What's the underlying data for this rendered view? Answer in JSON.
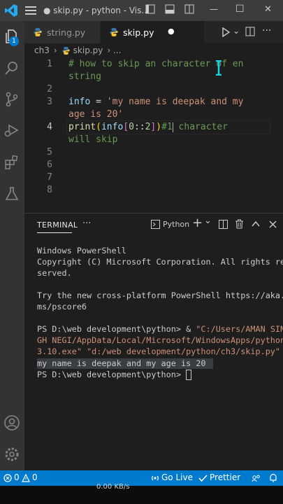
{
  "titlebar": {
    "title": "● skip.py - python - Vis...",
    "minimize": "—",
    "maximize": "☐",
    "close": "✕"
  },
  "activity": {
    "explorer_badge": "1"
  },
  "tabs": [
    {
      "label": "string.py",
      "active": false
    },
    {
      "label": "skip.py",
      "active": true,
      "dirty_marker": "●"
    }
  ],
  "breadcrumb": {
    "folder": "ch3",
    "separator": "›",
    "file": "skip.py",
    "more": "› ..."
  },
  "editor": {
    "line_numbers": [
      "1",
      "",
      "2",
      "3",
      "",
      "4",
      "",
      "5",
      "6",
      "7",
      "8"
    ],
    "lines": {
      "l1a": "# how to skip an character of en",
      "l1b": "string",
      "l3_var": "info",
      "l3_eq": " = ",
      "l3_str": "'my name is deepak and my",
      "l3_str2": "age is 20'",
      "l4_fn": "print",
      "l4_p1": "(",
      "l4_var": "info",
      "l4_b1": "[",
      "l4_num": "0",
      "l4_op": "::",
      "l4_num2": "2",
      "l4_b2": "]",
      "l4_p2": ")",
      "l4_cmt": "#1",
      "l4_cmt2": " character",
      "l4_cmt3": "will skip"
    }
  },
  "terminal_panel": {
    "tab": "TERMINAL",
    "more": "···",
    "shell": "Python",
    "add": "+",
    "chevron": "⌄"
  },
  "terminal": {
    "lines": [
      "Windows PowerShell",
      "Copyright (C) Microsoft Corporation. All rights re",
      "served.",
      "",
      "Try the new cross-platform PowerShell https://aka.",
      "ms/pscore6",
      "",
      "PS D:\\web development\\python> & ",
      "GH NEGI/AppData/Local/Microsoft/WindowsApps/python",
      "3.10.exe\" \"d:/web development/python/ch3/skip.py\"",
      "my name is deepak and my age is 20",
      "PS D:\\web development\\python> "
    ],
    "cmd_str_1": "\"C:/Users/AMAN SIN"
  },
  "statusbar": {
    "errors": "0",
    "warnings": "0",
    "golive": "Go Live",
    "prettier": "Prettier",
    "partial": "0.00 KB/s"
  },
  "colors": {
    "accent": "#007acc",
    "comment": "#6a9955",
    "string": "#ce9178",
    "variable": "#9cdcfe",
    "function": "#dcdcaa",
    "number": "#b5cea8"
  }
}
